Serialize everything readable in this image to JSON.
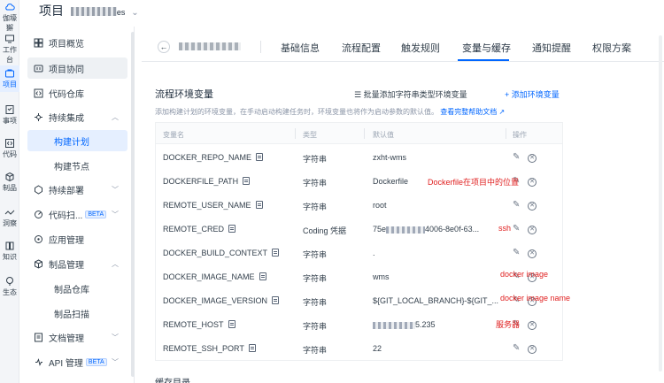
{
  "rail": [
    {
      "label": "伽壕獬",
      "icon": "cloud-icon"
    },
    {
      "label": "工作台",
      "icon": "monitor-icon"
    },
    {
      "label": "项目",
      "icon": "project-icon"
    },
    {
      "label": "事项",
      "icon": "task-icon"
    },
    {
      "label": "代码",
      "icon": "code-icon"
    },
    {
      "label": "制品",
      "icon": "cube-icon"
    },
    {
      "label": "洞察",
      "icon": "insight-icon"
    },
    {
      "label": "知识",
      "icon": "book-icon"
    },
    {
      "label": "生态",
      "icon": "ecosystem-icon"
    }
  ],
  "header": {
    "breadcrumb": "项目",
    "breadcrumb_suffix": "es"
  },
  "sidebar": {
    "items": [
      {
        "label": "项目概览",
        "icon": "grid-icon"
      },
      {
        "label": "项目协同",
        "icon": "collab-icon"
      },
      {
        "label": "代码仓库",
        "icon": "code-repo-icon"
      },
      {
        "label": "持续集成",
        "icon": "ci-icon"
      },
      {
        "label": "构建计划"
      },
      {
        "label": "构建节点"
      },
      {
        "label": "持续部署",
        "icon": "cd-icon"
      },
      {
        "label": "代码扫...",
        "icon": "scan-icon",
        "badge": "BETA"
      },
      {
        "label": "应用管理",
        "icon": "app-icon"
      },
      {
        "label": "制品管理",
        "icon": "artifact-icon"
      },
      {
        "label": "制品仓库"
      },
      {
        "label": "制品扫描"
      },
      {
        "label": "文档管理",
        "icon": "doc-icon"
      },
      {
        "label": "API 管理",
        "icon": "api-icon",
        "badge": "BETA"
      }
    ]
  },
  "tabs": [
    "基础信息",
    "流程配置",
    "触发规则",
    "变量与缓存",
    "通知提醒",
    "权限方案"
  ],
  "section": {
    "title": "流程环境变量",
    "description": "添加构建计划的环境变量，在手动启动构建任务时，环境变量也将作为启动参数的默认值。",
    "help_link": "查看完整帮助文档",
    "batch_label": "批量添加字符串类型环境变量",
    "add_label": "+ 添加环境变量"
  },
  "table": {
    "headers": [
      "变量名",
      "类型",
      "默认值",
      "操作"
    ],
    "rows": [
      {
        "name": "DOCKER_REPO_NAME",
        "type": "字符串",
        "value": "zxht-wms"
      },
      {
        "name": "DOCKERFILE_PATH",
        "type": "字符串",
        "value": "Dockerfile"
      },
      {
        "name": "REMOTE_USER_NAME",
        "type": "字符串",
        "value": "root"
      },
      {
        "name": "REMOTE_CRED",
        "type": "Coding 凭据",
        "value_prefix": "75e",
        "value_suffix": "4006-8e0f-63..."
      },
      {
        "name": "DOCKER_BUILD_CONTEXT",
        "type": "字符串",
        "value": "."
      },
      {
        "name": "DOCKER_IMAGE_NAME",
        "type": "字符串",
        "value": "wms"
      },
      {
        "name": "DOCKER_IMAGE_VERSION",
        "type": "字符串",
        "value": "${GIT_LOCAL_BRANCH}-${GIT_..."
      },
      {
        "name": "REMOTE_HOST",
        "type": "字符串",
        "value_suffix": "5.235"
      },
      {
        "name": "REMOTE_SSH_PORT",
        "type": "字符串",
        "value": "22"
      }
    ]
  },
  "annotations": [
    "Dockerfile在项目中的位置",
    "ssh",
    "docker image",
    "docker image name",
    "服务器"
  ],
  "cache_title": "缓存目录"
}
